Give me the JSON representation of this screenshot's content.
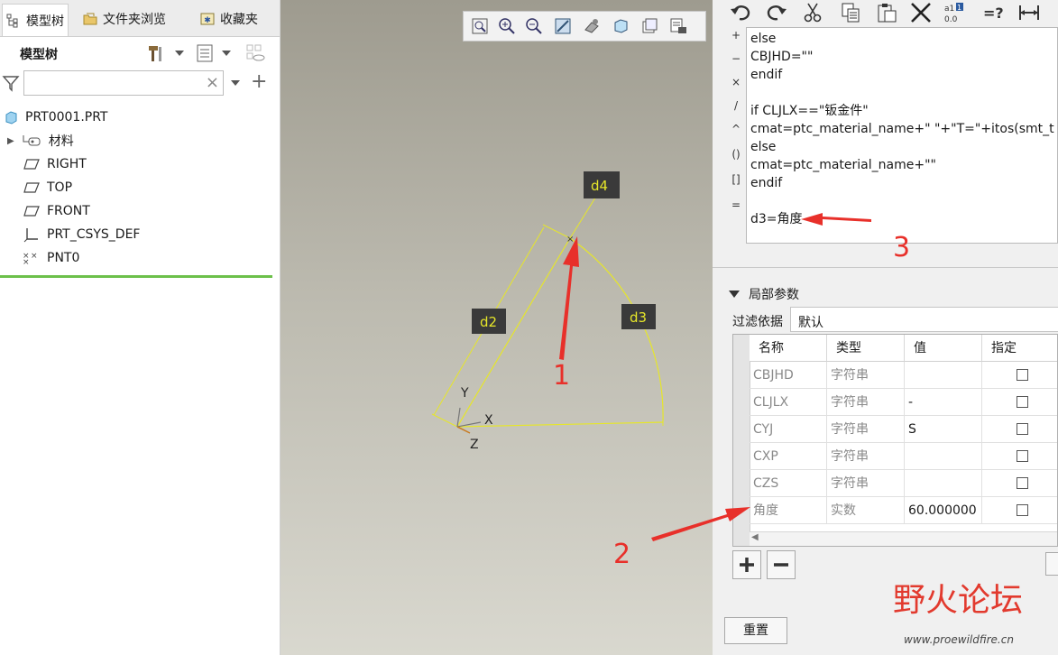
{
  "left_panel": {
    "tabs": [
      {
        "label": "模型树"
      },
      {
        "label": "文件夹浏览"
      },
      {
        "label": "收藏夹"
      }
    ],
    "subheader_title": "模型树",
    "search_placeholder": "",
    "tree": [
      {
        "label": "PRT0001.PRT",
        "icon": "part-icon"
      },
      {
        "label": "材料",
        "icon": "material-icon"
      },
      {
        "label": "RIGHT",
        "icon": "datum-plane-icon"
      },
      {
        "label": "TOP",
        "icon": "datum-plane-icon"
      },
      {
        "label": "FRONT",
        "icon": "datum-plane-icon"
      },
      {
        "label": "PRT_CSYS_DEF",
        "icon": "csys-icon"
      },
      {
        "label": "PNT0",
        "icon": "datum-point-icon"
      }
    ]
  },
  "viewport": {
    "dims": {
      "d2": "d2",
      "d3": "d3",
      "d4": "d4"
    },
    "axes": {
      "x": "X",
      "y": "Y",
      "z": "Z"
    }
  },
  "right_panel": {
    "operators": [
      "+",
      "−",
      "×",
      "/",
      "^",
      "()",
      "[]",
      "="
    ],
    "code_lines": [
      "else",
      "CBJHD=\"\"",
      "endif",
      "",
      "if CLJLX==\"钣金件\"",
      "cmat=ptc_material_name+\" \"+\"T=\"+itos(smt_t",
      "else",
      "cmat=ptc_material_name+\"\"",
      "endif",
      "",
      "d3=角度"
    ],
    "section_title": "局部参数",
    "filter_label": "过滤依据",
    "filter_value": "默认",
    "table": {
      "headers": [
        "名称",
        "类型",
        "值",
        "指定"
      ],
      "rows": [
        {
          "name": "CBJHD",
          "type": "字符串",
          "value": ""
        },
        {
          "name": "CLJLX",
          "type": "字符串",
          "value": "-"
        },
        {
          "name": "CYJ",
          "type": "字符串",
          "value": "S"
        },
        {
          "name": "CXP",
          "type": "字符串",
          "value": ""
        },
        {
          "name": "CZS",
          "type": "字符串",
          "value": ""
        },
        {
          "name": "角度",
          "type": "实数",
          "value": "60.000000"
        }
      ]
    },
    "reset_label": "重置"
  },
  "annotations": {
    "n1": "1",
    "n2": "2",
    "n3": "3"
  },
  "watermark": {
    "text": "野火论坛",
    "url": "www.proewildfire.cn"
  },
  "colors": {
    "annotation": "#e8302a",
    "sketch": "#e6e62a",
    "accent_green": "#6cc04a"
  }
}
